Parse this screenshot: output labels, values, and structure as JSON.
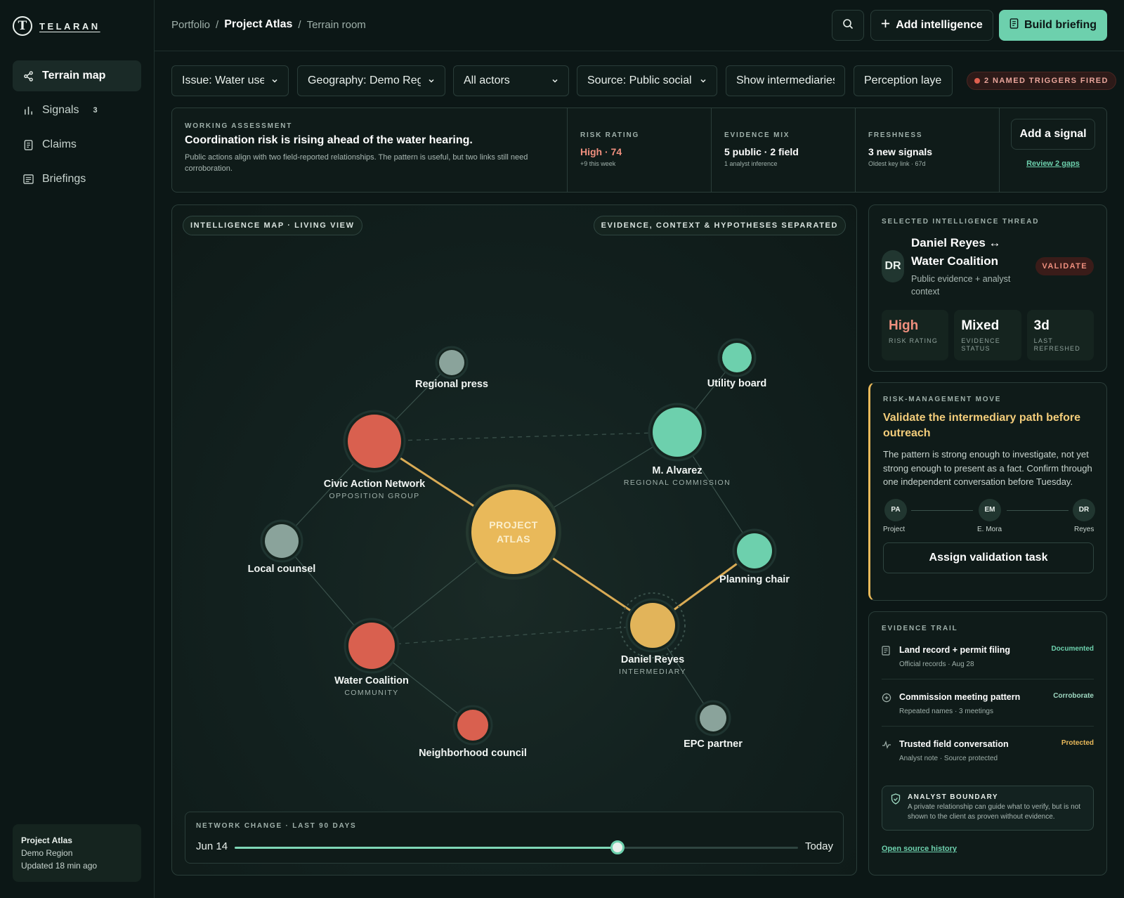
{
  "brand": {
    "name": "TELARAN",
    "mark": "T"
  },
  "sidebar": {
    "items": [
      {
        "label": "Terrain map",
        "icon": "share-network-icon",
        "active": true
      },
      {
        "label": "Signals",
        "icon": "bar-chart-icon",
        "badge": "3"
      },
      {
        "label": "Claims",
        "icon": "document-icon"
      },
      {
        "label": "Briefings",
        "icon": "briefing-icon"
      }
    ],
    "project_card": {
      "name": "Project Atlas",
      "region": "Demo Region",
      "updated": "Updated 18 min ago"
    }
  },
  "breadcrumb": {
    "root": "Portfolio",
    "separator": "/",
    "current": "Project Atlas",
    "page": "Terrain room"
  },
  "toolbar": {
    "search_icon": "search-icon",
    "add_label": "Add intelligence",
    "build_label": "Build briefing"
  },
  "filters": {
    "issue": "Issue: Water use",
    "geography": "Geography: Demo Region",
    "actors": "All actors",
    "source": "Source: Public social",
    "intermediaries": "Show intermediaries",
    "perception": "Perception layer",
    "triggers": "2 NAMED TRIGGERS FIRED"
  },
  "assessment": {
    "eyebrow": "WORKING ASSESSMENT",
    "title": "Coordination risk is rising ahead of the water hearing.",
    "body": "Public actions align with two field-reported relationships. The pattern is useful, but two links still need corroboration.",
    "metrics": [
      {
        "label": "RISK RATING",
        "value": "High · 74",
        "sub": "+9 this week"
      },
      {
        "label": "EVIDENCE MIX",
        "value": "5 public · 2 field",
        "sub": "1 analyst inference"
      },
      {
        "label": "FRESHNESS",
        "value": "3 new signals",
        "sub": "Oldest key link · 67d"
      }
    ],
    "add_signal": "Add a signal",
    "review": "Review 2 gaps"
  },
  "map": {
    "chip_left": "INTELLIGENCE MAP · LIVING VIEW",
    "chip_right": "EVIDENCE, CONTEXT & HYPOTHESES SEPARATED",
    "center_line1": "PROJECT",
    "center_line2": "ATLAS",
    "nodes": {
      "regional_press": {
        "label": "Regional press"
      },
      "utility_board": {
        "label": "Utility board"
      },
      "civic": {
        "label": "Civic Action Network",
        "sub": "OPPOSITION GROUP"
      },
      "alvarez": {
        "label": "M. Alvarez",
        "sub": "REGIONAL COMMISSION"
      },
      "local_counsel": {
        "label": "Local counsel"
      },
      "planning_chair": {
        "label": "Planning chair"
      },
      "water_coalition": {
        "label": "Water Coalition",
        "sub": "COMMUNITY"
      },
      "daniel_reyes": {
        "label": "Daniel Reyes",
        "sub": "INTERMEDIARY"
      },
      "neighborhood": {
        "label": "Neighborhood council"
      },
      "epc": {
        "label": "EPC partner"
      }
    },
    "colors": {
      "center": "#e9b95a",
      "risk": "#d9604f",
      "ally": "#6dd0ad",
      "neutral": "#8aa39b",
      "highlight": "#e2b45a"
    },
    "timeline": {
      "eyebrow": "NETWORK CHANGE · LAST 90 DAYS",
      "start": "Jun 14",
      "end": "Today",
      "position": 0.68
    }
  },
  "thread": {
    "eyebrow": "SELECTED INTELLIGENCE THREAD",
    "initials": "DR",
    "title": "Daniel Reyes ↔ Water Coalition",
    "desc": "Public evidence + analyst context",
    "status": "VALIDATE",
    "stats": [
      {
        "value": "High",
        "label": "RISK RATING"
      },
      {
        "value": "Mixed",
        "label": "EVIDENCE STATUS"
      },
      {
        "value": "3d",
        "label": "LAST REFRESHED"
      }
    ]
  },
  "move": {
    "eyebrow": "RISK-MANAGEMENT MOVE",
    "title": "Validate the intermediary path before outreach",
    "body": "The pattern is strong enough to investigate, not yet strong enough to present as a fact. Confirm through one independent conversation before Tuesday.",
    "path": [
      {
        "initials": "PA",
        "label": "Project"
      },
      {
        "initials": "EM",
        "label": "E. Mora"
      },
      {
        "initials": "DR",
        "label": "Reyes"
      }
    ],
    "assign": "Assign validation task"
  },
  "trail": {
    "eyebrow": "EVIDENCE TRAIL",
    "items": [
      {
        "title": "Land record + permit filing",
        "sub": "Official records · Aug 28",
        "tag": "Documented",
        "icon": "document-icon"
      },
      {
        "title": "Commission meeting pattern",
        "sub": "Repeated names · 3 meetings",
        "tag": "Corroborate",
        "icon": "plus-circle-icon"
      },
      {
        "title": "Trusted field conversation",
        "sub": "Analyst note · Source protected",
        "tag": "Protected",
        "icon": "pulse-icon"
      }
    ],
    "boundary": {
      "title": "ANALYST BOUNDARY",
      "body": "A private relationship can guide what to verify, but is not shown to the client as proven without evidence."
    },
    "link": "Open source history"
  }
}
